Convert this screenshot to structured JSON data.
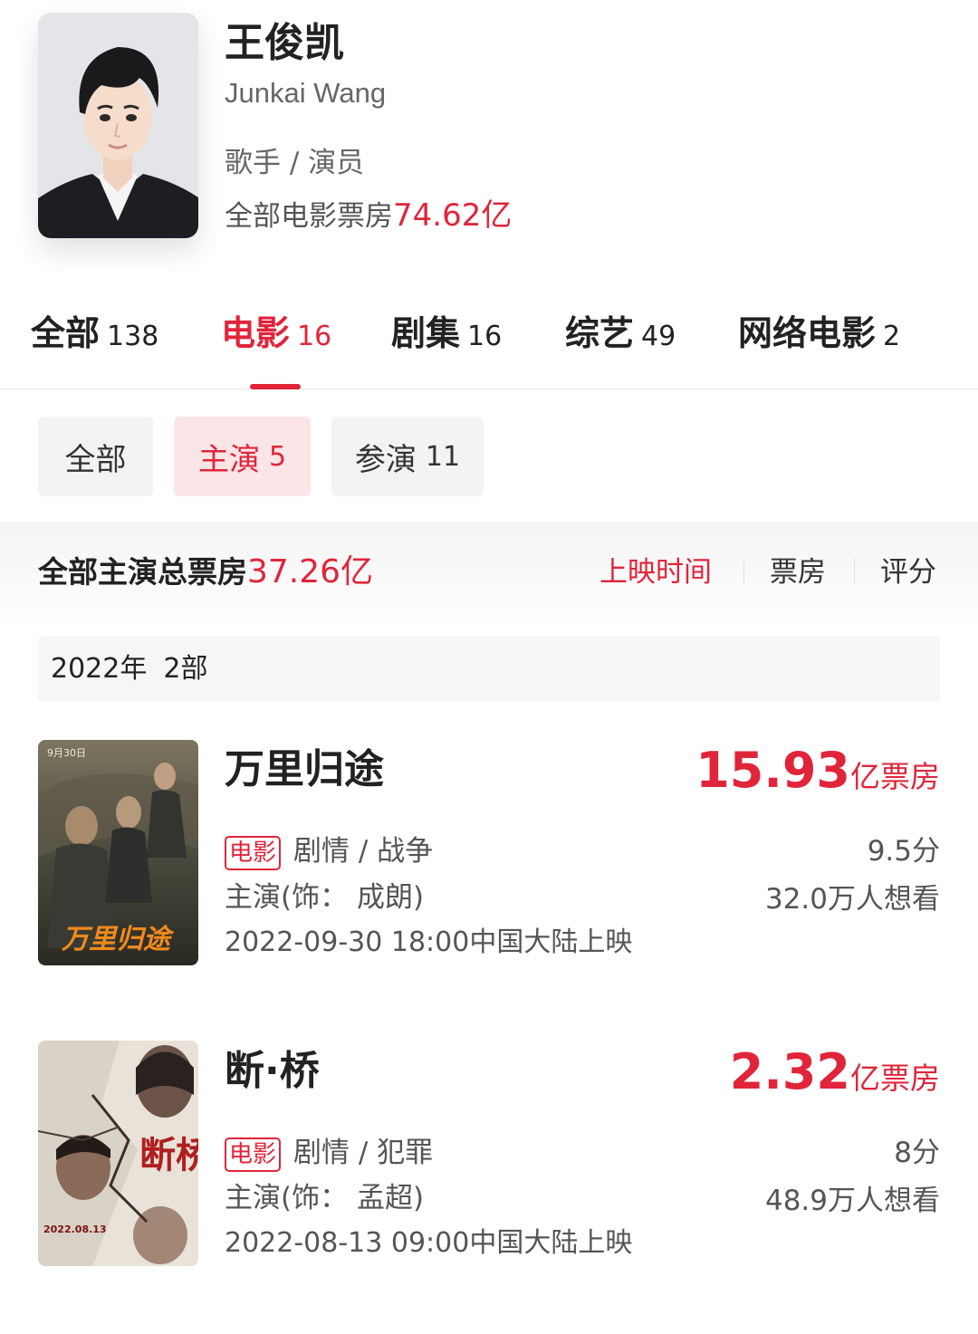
{
  "profile": {
    "name": "王俊凯",
    "english_name": "Junkai Wang",
    "role": "歌手 / 演员",
    "total_label": "全部电影票房",
    "total_value": "74.62亿"
  },
  "tabs": [
    {
      "label": "全部",
      "count": "138"
    },
    {
      "label": "电影",
      "count": "16"
    },
    {
      "label": "剧集",
      "count": "16"
    },
    {
      "label": "综艺",
      "count": "49"
    },
    {
      "label": "网络电影",
      "count": "2"
    }
  ],
  "active_tab": "电影",
  "chips": [
    {
      "label": "全部",
      "count": ""
    },
    {
      "label": "主演",
      "count": "5"
    },
    {
      "label": "参演",
      "count": "11"
    }
  ],
  "active_chip": "主演",
  "summary": {
    "label": "全部主演总票房",
    "value": "37.26亿"
  },
  "sort": [
    "上映时间",
    "票房",
    "评分"
  ],
  "active_sort": "上映时间",
  "year_group": {
    "year": "2022年",
    "count": "2部"
  },
  "movies": [
    {
      "title": "万里归途",
      "box_value": "15.93",
      "box_unit": "亿票房",
      "tag": "电影",
      "genre": "剧情 / 战争",
      "role": "主演(饰： 成朗)",
      "release": "2022-09-30 18:00中国大陆上映",
      "score": "9.5分",
      "want": "32.0万人想看",
      "poster_texts": {
        "date": "9月30日",
        "title": "万里归途"
      }
    },
    {
      "title": "断·桥",
      "box_value": "2.32",
      "box_unit": "亿票房",
      "tag": "电影",
      "genre": "剧情 / 犯罪",
      "role": "主演(饰： 孟超)",
      "release": "2022-08-13 09:00中国大陆上映",
      "score": "8分",
      "want": "48.9万人想看",
      "poster_texts": {
        "date": "2022.08.13",
        "title": "断桥"
      }
    }
  ],
  "colors": {
    "accent": "#e0253a",
    "chip_active_bg": "#fbe5e7"
  }
}
